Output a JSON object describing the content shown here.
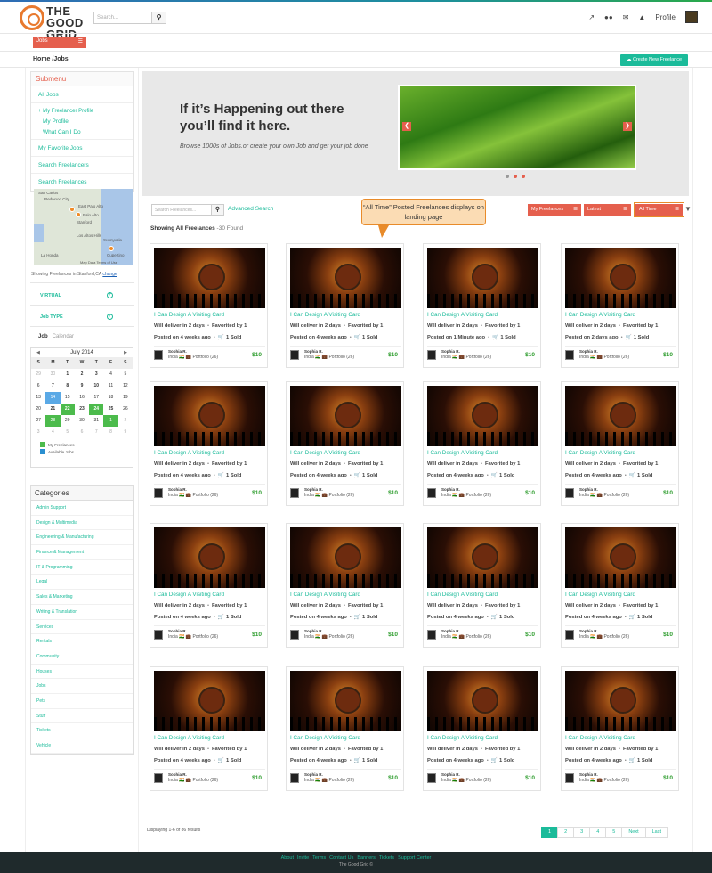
{
  "header": {
    "logo_text": "THE GOOD GRID",
    "search_placeholder": "Search...",
    "profile_label": "Profile",
    "icons": [
      "external-link-icon",
      "users-icon",
      "envelope-icon",
      "bell-icon"
    ]
  },
  "jobs_tab": "Jobs",
  "breadcrumb": "Home /Jobs",
  "create_button": "Create New Freelance",
  "sidebar": {
    "heading": "Submenu",
    "items": [
      "All Jobs",
      "+ My Freelancer Profile",
      "My Profile",
      "What Can I Do",
      "My Favorite Jobs",
      "Search Freelancers",
      "Search Freelances"
    ]
  },
  "map": {
    "labels": [
      "San Carlos",
      "Redwood City",
      "East Palo Alto",
      "Palo Alto",
      "Stanford",
      "Los Altos Hills",
      "Sunnyvale",
      "La Honda",
      "Cupertino"
    ],
    "attribution": "Map Data   Terms of Use",
    "caption": "Showing Freelances in Stanford,CA",
    "change_link": "change"
  },
  "filters": {
    "virtual": "VIRTUAL",
    "job_type": "Job TYPE",
    "job": "Job",
    "calendar": "Calendar"
  },
  "calendar": {
    "month": "July 2014",
    "prev": "◀",
    "next": "▶",
    "dow": [
      "S",
      "M",
      "T",
      "W",
      "T",
      "F",
      "S"
    ],
    "days": [
      "29",
      "30",
      "1",
      "2",
      "3",
      "4",
      "5",
      "6",
      "7",
      "8",
      "9",
      "10",
      "11",
      "12",
      "13",
      "14",
      "15",
      "16",
      "17",
      "18",
      "19",
      "20",
      "21",
      "22",
      "23",
      "24",
      "25",
      "26",
      "27",
      "28",
      "29",
      "30",
      "31",
      "1",
      "2",
      "3",
      "4",
      "5",
      "6",
      "7",
      "8",
      "9"
    ],
    "legend_favorites": "My Freelances",
    "legend_available": "Available Jobs",
    "color_favorites": "#4cbb4c",
    "color_available": "#2a8fd0"
  },
  "categories": {
    "heading": "Categories",
    "items": [
      "Admin Support",
      "Design & Multimedia",
      "Engineering & Manufacturing",
      "Finance & Management",
      "IT & Programming",
      "Legal",
      "Sales & Marketing",
      "Writing & Translation",
      "Services",
      "Rentals",
      "Community",
      "Houses",
      "Jobs",
      "Pets",
      "Stuff",
      "Tickets",
      "Vehicle"
    ]
  },
  "banner": {
    "title": "If it’s Happening out there you’ll find it here.",
    "subtitle": "Browse 1000s of Jobs.or create your own Job and get your job done"
  },
  "toolbar": {
    "search_placeholder": "Search Freelances...",
    "advanced": "Advanced Search",
    "callout": "“All Time” Posted Freelances displays on landing page",
    "dd_my": "My Freelances",
    "dd_latest": "Latest",
    "dd_time": "All Time"
  },
  "showing": {
    "label": "Showing All Freelances",
    "count": " -30 Found"
  },
  "cards": [
    {
      "title": "I Can Design A Visiting Card",
      "deliver": "Will deliver in 2 days",
      "fav": "Favorited by 1",
      "posted": "Posted on 4 weeks ago",
      "sold": "1 Sold",
      "name": "Sophia R.",
      "meta": "India 🇮🇳 💼 Portfolio (26)",
      "price": "$10"
    },
    {
      "title": "I Can Design A Visiting Card",
      "deliver": "Will deliver in 2 days",
      "fav": "Favorited by 1",
      "posted": "Posted on 4 weeks ago",
      "sold": "1 Sold",
      "name": "Sophia R.",
      "meta": "India 🇮🇳 💼 Portfolio (26)",
      "price": "$10"
    },
    {
      "title": "I Can Design A Visiting Card",
      "deliver": "Will deliver in 2 days",
      "fav": "Favorited by 1",
      "posted": "Posted on 1 Minute ago",
      "sold": "1 Sold",
      "name": "Sophia R.",
      "meta": "India 🇮🇳 💼 Portfolio (26)",
      "price": "$10"
    },
    {
      "title": "I Can Design A Visiting Card",
      "deliver": "Will deliver in 2 days",
      "fav": "Favorited by 1",
      "posted": "Posted on 2 days ago",
      "sold": "1 Sold",
      "name": "Sophia R.",
      "meta": "India 🇮🇳 💼 Portfolio (26)",
      "price": "$10"
    },
    {
      "title": "I Can Design A Visiting Card",
      "deliver": "Will deliver in 2 days",
      "fav": "Favorited by 1",
      "posted": "Posted on 4 weeks ago",
      "sold": "1 Sold",
      "name": "Sophia R.",
      "meta": "India 🇮🇳 💼 Portfolio (26)",
      "price": "$10"
    },
    {
      "title": "I Can Design A Visiting Card",
      "deliver": "Will deliver in 2 days",
      "fav": "Favorited by 1",
      "posted": "Posted on 4 weeks ago",
      "sold": "1 Sold",
      "name": "Sophia R.",
      "meta": "India 🇮🇳 💼 Portfolio (26)",
      "price": "$10"
    },
    {
      "title": "I Can Design A Visiting Card",
      "deliver": "Will deliver in 2 days",
      "fav": "Favorited by 1",
      "posted": "Posted on 4 weeks ago",
      "sold": "1 Sold",
      "name": "Sophia R.",
      "meta": "India 🇮🇳 💼 Portfolio (26)",
      "price": "$10"
    },
    {
      "title": "I Can Design A Visiting Card",
      "deliver": "Will deliver in 2 days",
      "fav": "Favorited by 1",
      "posted": "Posted on 4 weeks ago",
      "sold": "1 Sold",
      "name": "Sophia R.",
      "meta": "India 🇮🇳 💼 Portfolio (26)",
      "price": "$10"
    },
    {
      "title": "I Can Design A Visiting Card",
      "deliver": "Will deliver in 2 days",
      "fav": "Favorited by 1",
      "posted": "Posted on 4 weeks ago",
      "sold": "1 Sold",
      "name": "Sophia R.",
      "meta": "India 🇮🇳 💼 Portfolio (26)",
      "price": "$10"
    },
    {
      "title": "I Can Design A Visiting Card",
      "deliver": "Will deliver in 2 days",
      "fav": "Favorited by 1",
      "posted": "Posted on 4 weeks ago",
      "sold": "1 Sold",
      "name": "Sophia R.",
      "meta": "India 🇮🇳 💼 Portfolio (26)",
      "price": "$10"
    },
    {
      "title": "I Can Design A Visiting Card",
      "deliver": "Will deliver in 2 days",
      "fav": "Favorited by 1",
      "posted": "Posted on 4 weeks ago",
      "sold": "1 Sold",
      "name": "Sophia R.",
      "meta": "India 🇮🇳 💼 Portfolio (26)",
      "price": "$10"
    },
    {
      "title": "I Can Design A Visiting Card",
      "deliver": "Will deliver in 2 days",
      "fav": "Favorited by 1",
      "posted": "Posted on 4 weeks ago",
      "sold": "1 Sold",
      "name": "Sophia R.",
      "meta": "India 🇮🇳 💼 Portfolio (26)",
      "price": "$10"
    },
    {
      "title": "I Can Design A Visiting Card",
      "deliver": "Will deliver in 2 days",
      "fav": "Favorited by 1",
      "posted": "Posted on 4 weeks ago",
      "sold": "1 Sold",
      "name": "Sophia R.",
      "meta": "India 🇮🇳 💼 Portfolio (26)",
      "price": "$10"
    },
    {
      "title": "I Can Design A Visiting Card",
      "deliver": "Will deliver in 2 days",
      "fav": "Favorited by 1",
      "posted": "Posted on 4 weeks ago",
      "sold": "1 Sold",
      "name": "Sophia R.",
      "meta": "India 🇮🇳 💼 Portfolio (26)",
      "price": "$10"
    },
    {
      "title": "I Can Design A Visiting Card",
      "deliver": "Will deliver in 2 days",
      "fav": "Favorited by 1",
      "posted": "Posted on 4 weeks ago",
      "sold": "1 Sold",
      "name": "Sophia R.",
      "meta": "India 🇮🇳 💼 Portfolio (26)",
      "price": "$10"
    },
    {
      "title": "I Can Design A Visiting Card",
      "deliver": "Will deliver in 2 days",
      "fav": "Favorited by 1",
      "posted": "Posted on 4 weeks ago",
      "sold": "1 Sold",
      "name": "Sophia R.",
      "meta": "India 🇮🇳 💼 Portfolio (26)",
      "price": "$10"
    }
  ],
  "pagination": {
    "info": "Displaying 1-6 of 86 results",
    "pages": [
      "1",
      "2",
      "3",
      "4",
      "5",
      "Next",
      "Last"
    ]
  },
  "footer": {
    "links": [
      "About",
      "Invite",
      "Terms",
      "Contact Us",
      "Banners",
      "Tickets",
      "Support Center"
    ],
    "copyright": "The Good Grid ©"
  },
  "colors": {
    "accent": "#1bbb9a",
    "brand": "#e55f4d",
    "callout": "#fbdcb4"
  }
}
